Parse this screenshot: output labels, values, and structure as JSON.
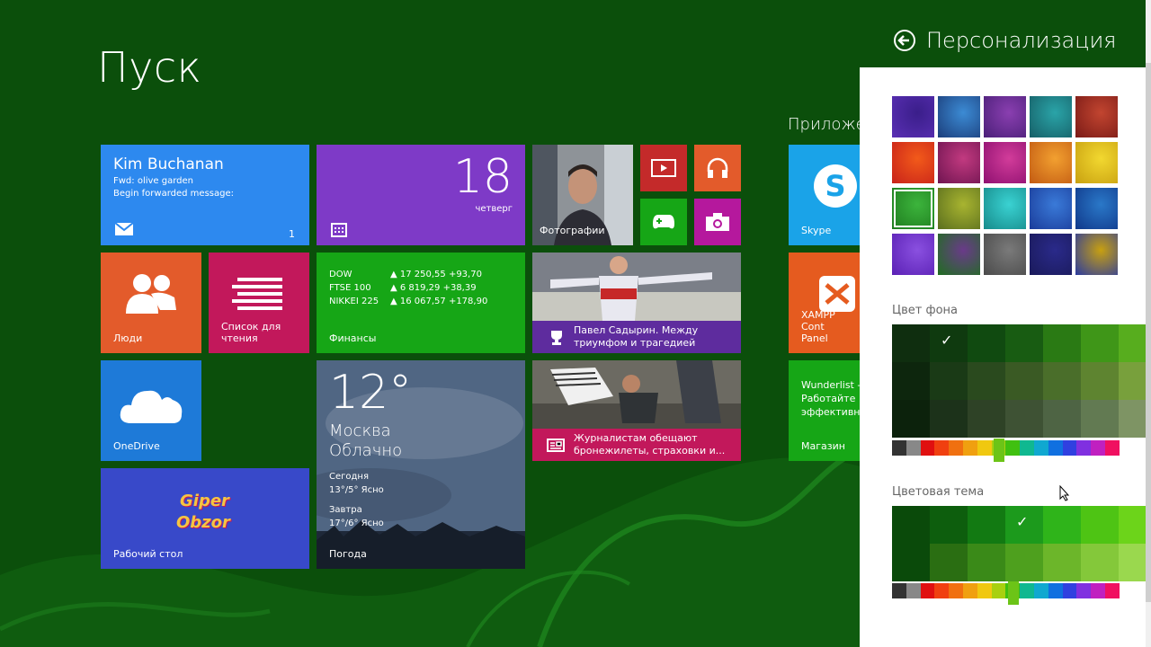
{
  "start": {
    "title": "Пуск"
  },
  "section": {
    "label": "Приложе"
  },
  "tiles": {
    "mail": {
      "name": "Kim Buchanan",
      "line1": "Fwd: olive garden",
      "line2": "Begin forwarded message:",
      "badge": "1"
    },
    "calendar": {
      "day": "18",
      "weekday": "четверг"
    },
    "photos": {
      "label": "Фотографии"
    },
    "people": {
      "label": "Люди"
    },
    "reading": {
      "label": "Список для\nчтения"
    },
    "finance": {
      "label": "Финансы",
      "rows": [
        {
          "name": "DOW",
          "value": "▲ 17 250,55 +93,70"
        },
        {
          "name": "FTSE 100",
          "value": "▲ 6 819,29 +38,39"
        },
        {
          "name": "NIKKEI 225",
          "value": "▲ 16 067,57 +178,90"
        }
      ]
    },
    "sport": {
      "text": "Павел Садырин. Между триумфом и трагедией"
    },
    "onedrive": {
      "label": "OneDrive"
    },
    "weather": {
      "temp": "12°",
      "city": "Москва",
      "cond": "Облачно",
      "today": "Сегодня",
      "today_val": "13°/5° Ясно",
      "tomorrow": "Завтра",
      "tomorrow_val": "17°/6° Ясно",
      "label": "Погода"
    },
    "news": {
      "text": "Журналистам обещают бронежилеты, страховки и..."
    },
    "desktop": {
      "label": "Рабочий стол",
      "logo1": "Giper",
      "logo2": "Obzor"
    },
    "skype": {
      "label": "Skype"
    },
    "xampp": {
      "label": "XAMPP Cont\nPanel"
    },
    "wunderlist": {
      "label": "Wunderlist -\nРаботайте\nэффективно",
      "label2": "Магазин"
    }
  },
  "panel": {
    "title": "Персонализация",
    "bg_label": "Цвет фона",
    "theme_label": "Цветовая тема",
    "check": "✓"
  },
  "colors": {
    "start_bg": "#0b4f0b",
    "mail": "#2d89ef",
    "calendar": "#7e3ac7",
    "people": "#e35b2b",
    "reading": "#c2185b",
    "finance": "#16a616",
    "onedrive": "#1e7ad8",
    "desktop": "#3849c9",
    "skype": "#1aa3e8",
    "xampp": "#e55b1f",
    "wunderlist": "#16a616"
  }
}
